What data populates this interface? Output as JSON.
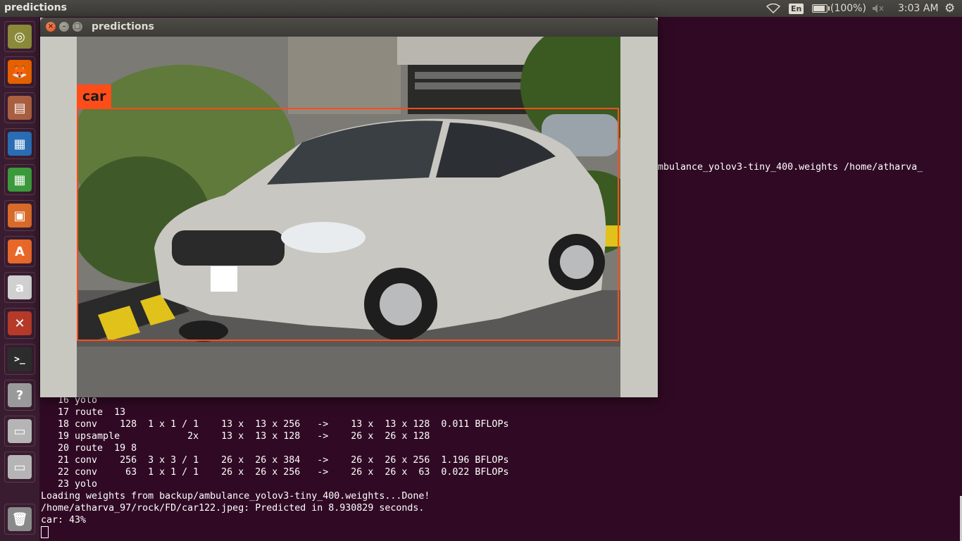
{
  "top_panel": {
    "app_title": "predictions",
    "lang": "En",
    "battery": "(100%)",
    "battery_level": 1.0,
    "clock": "3:03 AM",
    "icons": [
      "wifi-icon",
      "keyboard-lang-indicator",
      "battery-icon",
      "volume-muted-icon",
      "settings-gear-icon"
    ]
  },
  "launcher": {
    "items": [
      {
        "name": "ubuntu-dash",
        "icon": "ubuntu-logo-icon",
        "color": "#8b8a3a"
      },
      {
        "name": "firefox",
        "icon": "firefox-icon",
        "color": "#e66000"
      },
      {
        "name": "files",
        "icon": "file-cabinet-icon",
        "color": "#a95f40"
      },
      {
        "name": "libreoffice-writer",
        "icon": "writer-document-icon",
        "color": "#2a6db5"
      },
      {
        "name": "libreoffice-calc",
        "icon": "calc-spreadsheet-icon",
        "color": "#3b9a3b"
      },
      {
        "name": "libreoffice-impress",
        "icon": "impress-presentation-icon",
        "color": "#d86a2a"
      },
      {
        "name": "ubuntu-software",
        "icon": "software-bag-icon",
        "color": "#e8682a"
      },
      {
        "name": "amazon",
        "icon": "amazon-icon",
        "color": "#d0d0d0"
      },
      {
        "name": "system-settings",
        "icon": "settings-tools-icon",
        "color": "#b63a2a"
      },
      {
        "name": "terminal",
        "icon": "terminal-icon",
        "color": "#2d2d2d"
      },
      {
        "name": "help",
        "icon": "help-question-icon",
        "color": "#9a9a9a"
      },
      {
        "name": "drive-1",
        "icon": "hard-drive-icon",
        "color": "#b5b5b5"
      },
      {
        "name": "drive-2",
        "icon": "hard-drive-icon",
        "color": "#b5b5b5"
      },
      {
        "name": "trash",
        "icon": "trash-icon",
        "color": "#8a8a8a"
      }
    ]
  },
  "window": {
    "title": "predictions",
    "detection_label": "car"
  },
  "terminal": {
    "right_fragment": "mbulance_yolov3-tiny_400.weights /home/atharva_",
    "lines": [
      "   16 yolo",
      "   17 route  13",
      "   18 conv    128  1 x 1 / 1    13 x  13 x 256   ->    13 x  13 x 128  0.011 BFLOPs",
      "   19 upsample            2x    13 x  13 x 128   ->    26 x  26 x 128",
      "   20 route  19 8",
      "   21 conv    256  3 x 3 / 1    26 x  26 x 384   ->    26 x  26 x 256  1.196 BFLOPs",
      "   22 conv     63  1 x 1 / 1    26 x  26 x 256   ->    26 x  26 x  63  0.022 BFLOPs",
      "   23 yolo",
      "Loading weights from backup/ambulance_yolov3-tiny_400.weights...Done!",
      "/home/atharva_97/rock/FD/car122.jpeg: Predicted in 8.930829 seconds.",
      "car: 43%"
    ]
  }
}
